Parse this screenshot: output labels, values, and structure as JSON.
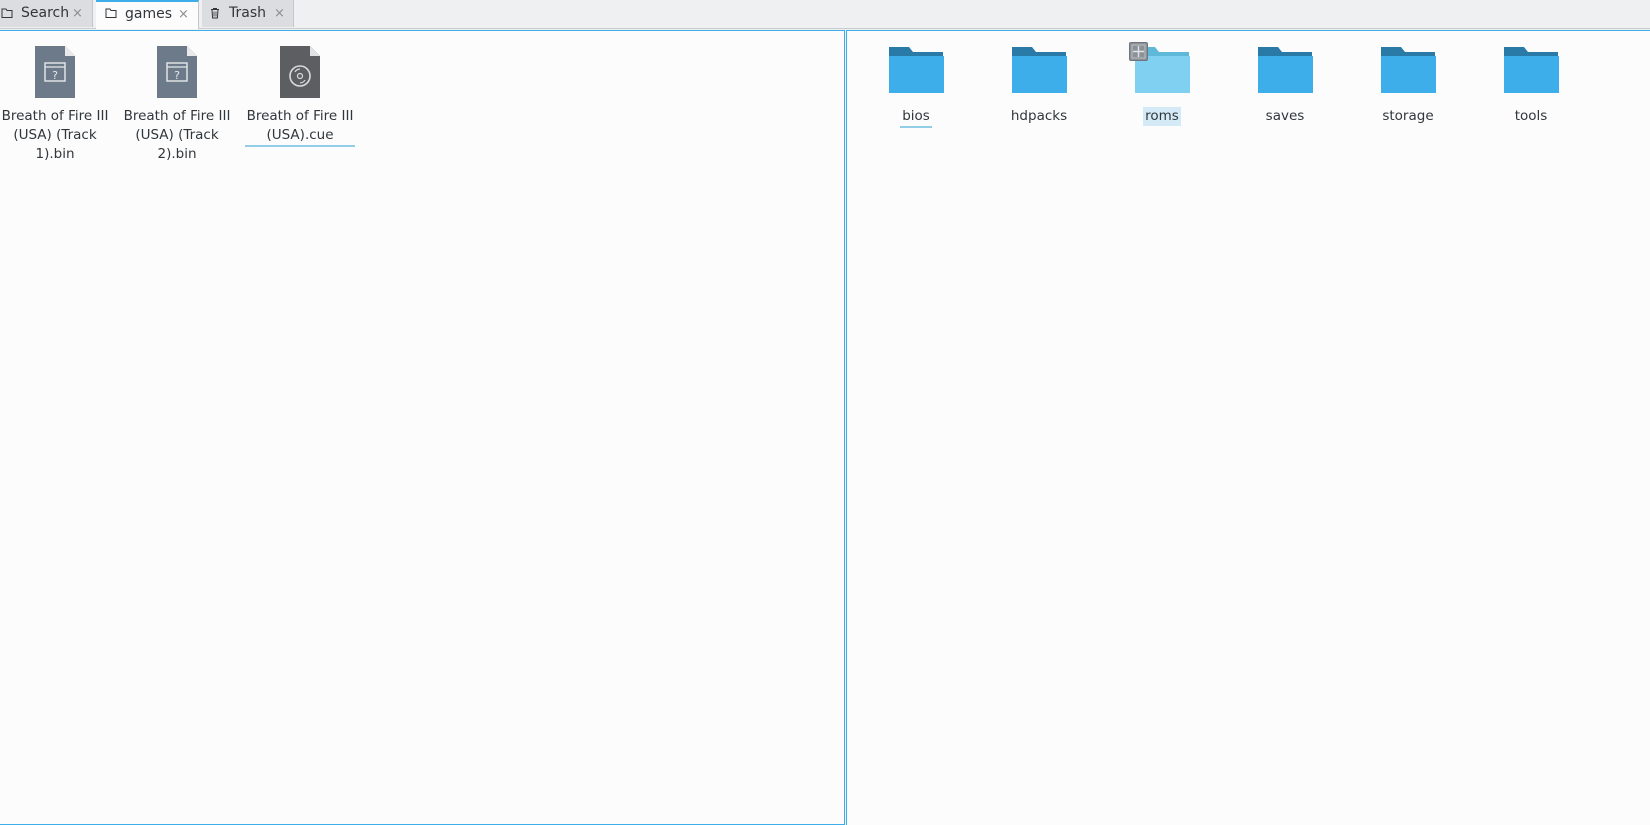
{
  "tabs": [
    {
      "label": "Search",
      "icon": "folder-icon",
      "close": "×",
      "active": false
    },
    {
      "label": "games",
      "icon": "folder-icon",
      "close": "×",
      "active": true
    },
    {
      "label": "Trash",
      "icon": "trash-icon",
      "close": "×",
      "active": false
    }
  ],
  "left_pane": {
    "files": [
      {
        "name": "Breath of Fire III\n(USA) (Track 1).bin",
        "icon": "unknown-file-icon"
      },
      {
        "name": "Breath of Fire III\n(USA) (Track 2).bin",
        "icon": "unknown-file-icon"
      },
      {
        "name": "Breath of Fire III\n(USA).cue",
        "icon": "cue-disc-file-icon"
      }
    ]
  },
  "right_pane": {
    "folders": [
      {
        "name": "bios"
      },
      {
        "name": "hdpacks"
      },
      {
        "name": "roms"
      },
      {
        "name": "saves"
      },
      {
        "name": "storage"
      },
      {
        "name": "tools"
      }
    ]
  },
  "colors": {
    "accent": "#3daee9",
    "folder_body": "#3daee9",
    "folder_tab": "#2a7aa8",
    "folder_hover": "#7fd0f1",
    "file_icon": "#6c7a89"
  }
}
